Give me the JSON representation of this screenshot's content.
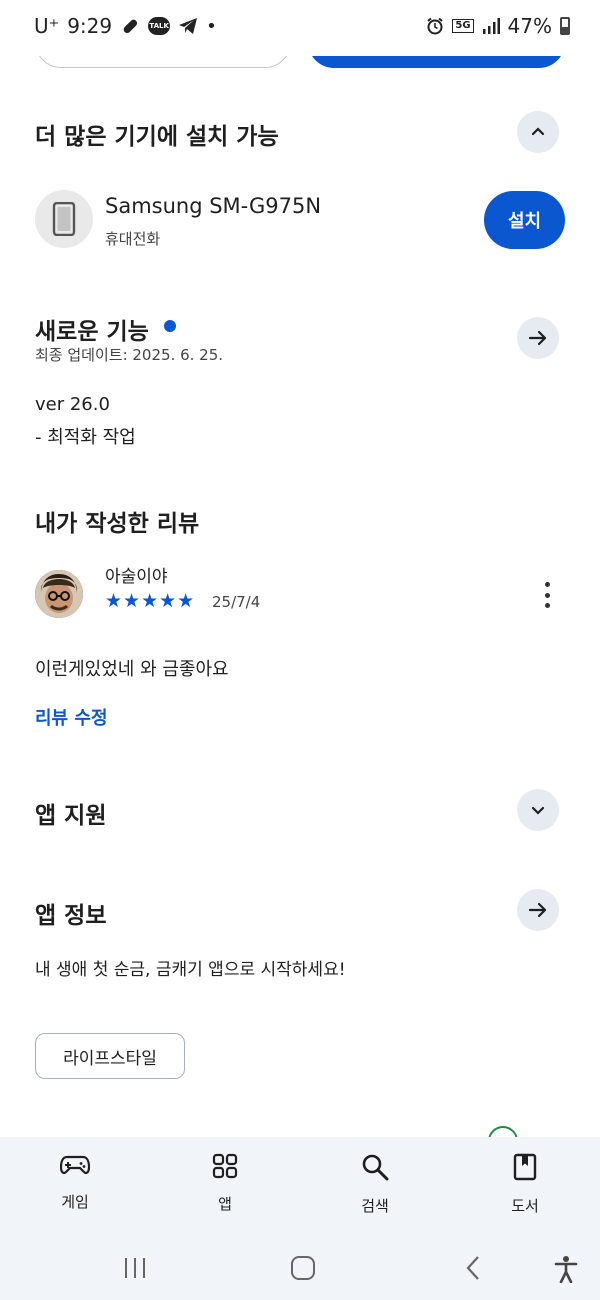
{
  "status_bar": {
    "carrier": "U⁺",
    "time": "9:29",
    "talk_badge": "TALK",
    "network": "5G",
    "battery": "47%"
  },
  "more_devices": {
    "title": "더 많은 기기에 설치 가능",
    "device_name": "Samsung SM-G975N",
    "device_type": "휴대전화",
    "install_label": "설치"
  },
  "whats_new": {
    "title": "새로운 기능",
    "updated": "최종 업데이트: 2025. 6. 25.",
    "version": "ver 26.0",
    "note": "- 최적화 작업"
  },
  "my_review": {
    "title": "내가 작성한 리뷰",
    "reviewer": "아술이야",
    "stars": "★★★★★",
    "rating": 5,
    "date": "25/7/4",
    "text": "이런게있었네 와 금좋아요",
    "edit_label": "리뷰 수정"
  },
  "app_support": {
    "title": "앱 지원"
  },
  "app_info": {
    "title": "앱 정보",
    "description": "내 생애 첫 순금, 금캐기 앱으로 시작하세요!",
    "category_chip": "라이프스타일"
  },
  "bottom_nav": {
    "items": [
      {
        "label": "게임",
        "icon": "gamepad-icon"
      },
      {
        "label": "앱",
        "icon": "apps-grid-icon"
      },
      {
        "label": "검색",
        "icon": "search-icon"
      },
      {
        "label": "도서",
        "icon": "book-icon"
      }
    ]
  },
  "colors": {
    "accent": "#0b57d0",
    "round_button_bg": "#e6eaf1",
    "nav_bg": "#f1f4f9"
  }
}
